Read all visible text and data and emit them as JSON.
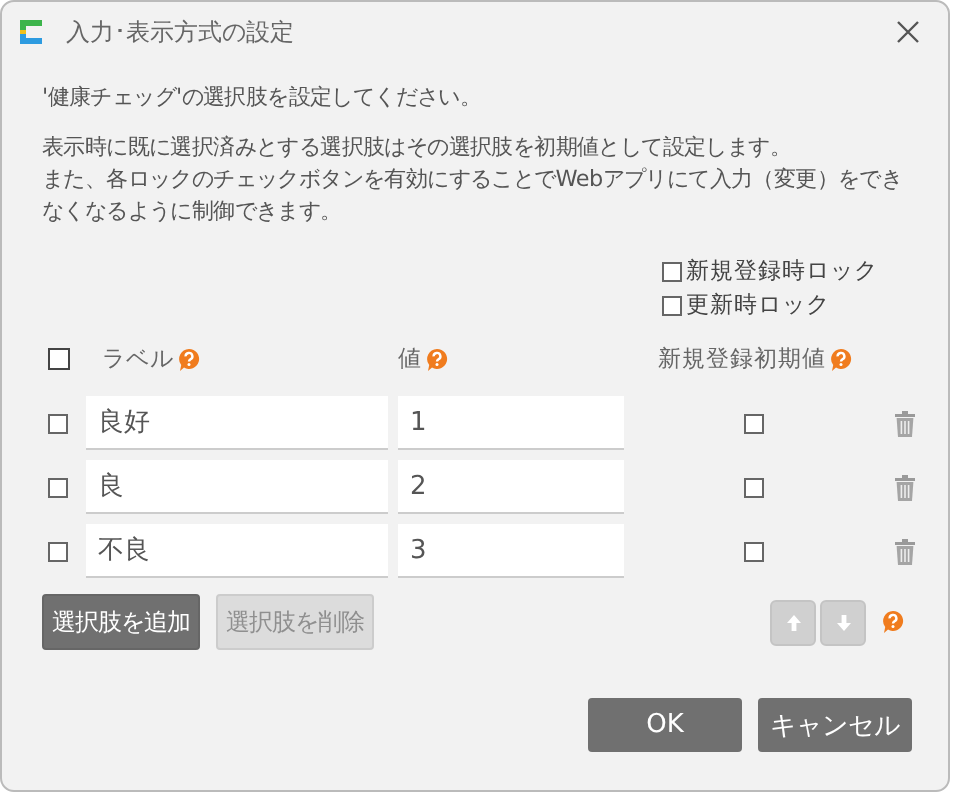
{
  "window": {
    "title": "入力･表示方式の設定"
  },
  "intro": [
    "'健康チェッグ'の選択肢を設定してください。",
    "表示時に既に選択済みとする選択肢はその選択肢を初期値として設定します。",
    "また、各ロックのチェックボタンを有効にすることでWebアプリにて入力（変更）をできなくなるように制御できます。"
  ],
  "locks": [
    {
      "label": "新規登録時ロック",
      "checked": false
    },
    {
      "label": "更新時ロック",
      "checked": false
    }
  ],
  "table": {
    "select_all": {
      "checked": false
    },
    "columns": [
      {
        "label": "ラベル"
      },
      {
        "label": "値"
      },
      {
        "label": "新規登録初期値"
      }
    ],
    "rows": [
      {
        "selected": false,
        "label": "良好",
        "value": "1",
        "default": false
      },
      {
        "selected": false,
        "label": "良",
        "value": "2",
        "default": false
      },
      {
        "selected": false,
        "label": "不良",
        "value": "3",
        "default": false
      }
    ]
  },
  "actions": [
    {
      "label": "選択肢を追加",
      "disabled": false
    },
    {
      "label": "選択肢を削除",
      "disabled": true
    }
  ],
  "move_buttons": [
    {
      "kind": "up",
      "disabled": true
    },
    {
      "kind": "down",
      "disabled": true
    }
  ],
  "buttons": [
    "OK",
    "キャンセル"
  ]
}
